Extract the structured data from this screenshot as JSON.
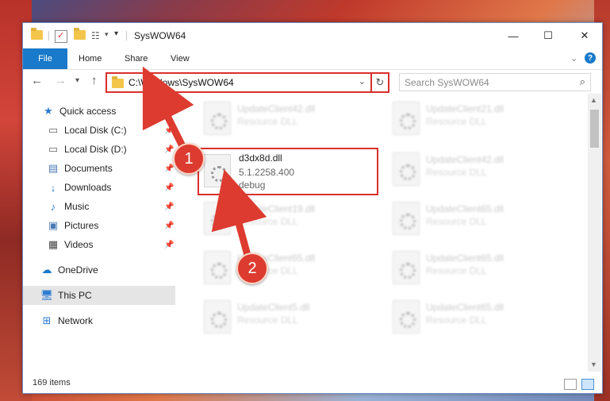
{
  "window": {
    "title": "SysWOW64",
    "minimize": "—",
    "maximize": "☐",
    "close": "✕"
  },
  "ribbon": {
    "tabs": [
      "File",
      "Home",
      "Share",
      "View"
    ]
  },
  "nav": {
    "address": "C:\\Windows\\SysWOW64",
    "search_placeholder": "Search SysWOW64"
  },
  "sidebar": {
    "items": [
      {
        "label": "Quick access",
        "icon": "star-icon"
      },
      {
        "label": "Local Disk (C:)",
        "icon": "drive-icon"
      },
      {
        "label": "Local Disk (D:)",
        "icon": "drive-icon"
      },
      {
        "label": "Documents",
        "icon": "documents-icon"
      },
      {
        "label": "Downloads",
        "icon": "download-icon"
      },
      {
        "label": "Music",
        "icon": "music-icon"
      },
      {
        "label": "Pictures",
        "icon": "pictures-icon"
      },
      {
        "label": "Videos",
        "icon": "videos-icon"
      },
      {
        "label": "OneDrive",
        "icon": "cloud-icon"
      },
      {
        "label": "This PC",
        "icon": "computer-icon"
      },
      {
        "label": "Network",
        "icon": "network-icon"
      }
    ]
  },
  "files": [
    {
      "name": "UpdateClient42.dll",
      "type": "Resource DLL"
    },
    {
      "name": "UpdateClient21.dll",
      "type": "Resource DLL"
    },
    {
      "name": "UpdateClient42.dll",
      "type": "Resource DLL"
    },
    {
      "name": "UpdateClient19.dll",
      "type": "Resource DLL"
    },
    {
      "name": "UpdateClient65.dll",
      "type": "Resource DLL"
    },
    {
      "name": "UpdateClient65.dll",
      "type": "Resource DLL"
    },
    {
      "name": "UpdateClient65.dll",
      "type": "Resource DLL"
    },
    {
      "name": "UpdateClient5.dll",
      "type": "Resource DLL"
    },
    {
      "name": "UpdateClient65.dll",
      "type": "Resource DLL"
    }
  ],
  "highlighted_file": {
    "name": "d3dx8d.dll",
    "version": "5.1.2258.400",
    "description": "debug"
  },
  "status": {
    "item_count": "169 items"
  },
  "annotations": [
    "1",
    "2"
  ],
  "colors": {
    "accent": "#1979ca",
    "annotation": "#dd3b30",
    "selected_nav": "#e5e5e5"
  }
}
